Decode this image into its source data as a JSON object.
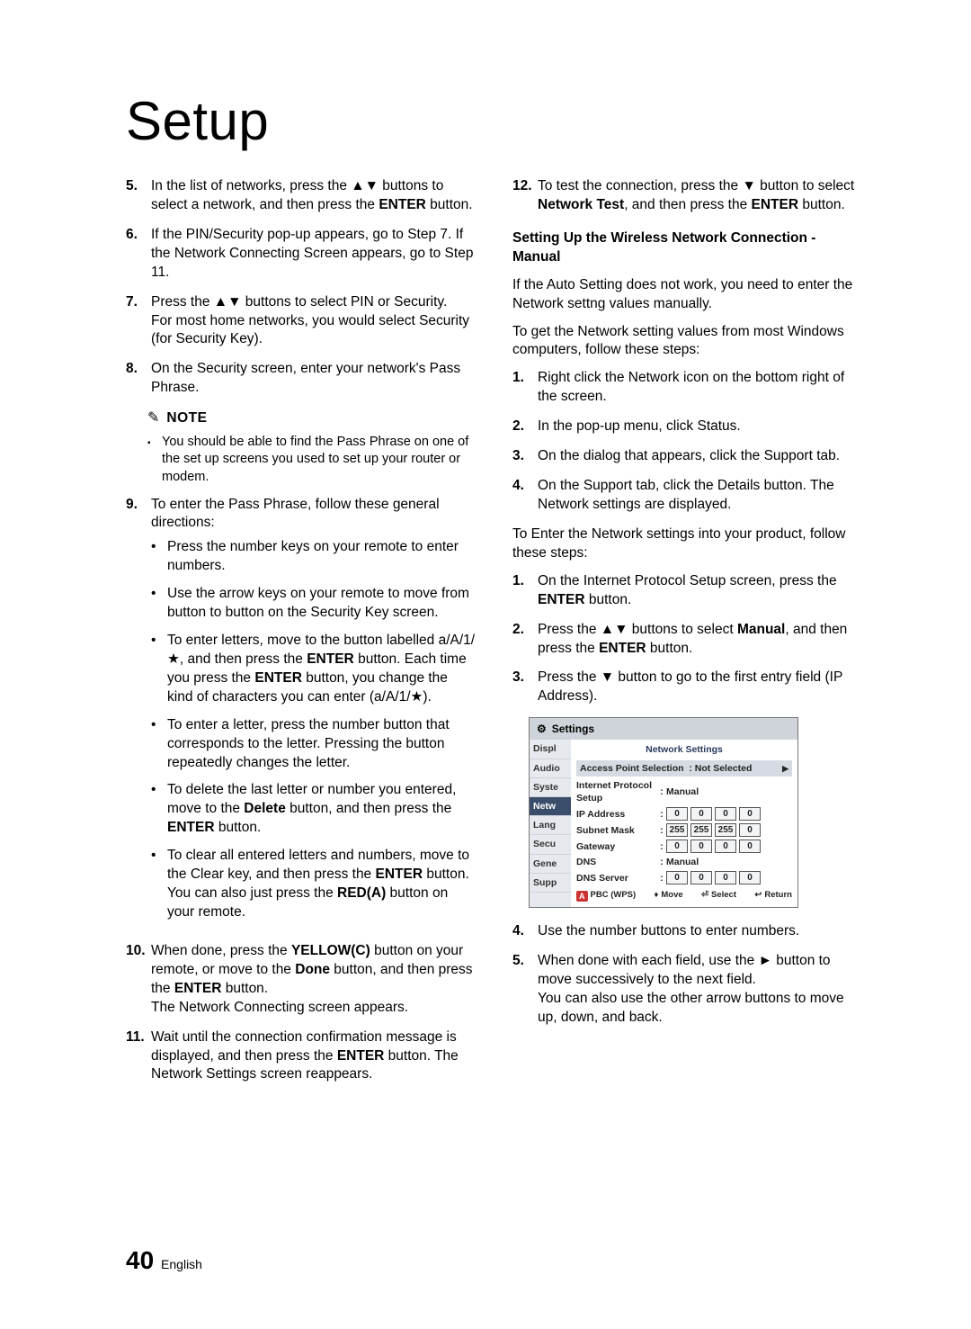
{
  "title": "Setup",
  "left": {
    "items": [
      {
        "num": "5.",
        "html": "In the list of networks, press the ▲▼ buttons to select a network, and then press the <b>ENTER</b> button."
      },
      {
        "num": "6.",
        "html": "If the PIN/Security pop-up appears, go to Step 7. If the Network Connecting Screen appears, go to Step 11."
      },
      {
        "num": "7.",
        "html": "Press the ▲▼ buttons to select PIN or Security.<br>For most home networks, you would select Security (for Security Key)."
      },
      {
        "num": "8.",
        "html": "On the Security screen, enter your network's Pass Phrase."
      }
    ],
    "note_label": "NOTE",
    "note_bullets": [
      "You should be able to find the Pass Phrase on one of the set up screens you used to set up your router or modem."
    ],
    "items2": [
      {
        "num": "9.",
        "html": "To enter the Pass Phrase, follow these general directions:",
        "bullets": [
          "Press the number keys on your remote to enter numbers.",
          "Use the arrow keys on your remote to move from button to button on the Security Key screen.",
          "To enter letters, move to the button labelled a/A/1/★, and then press the <b>ENTER</b> button. Each time you press the <b>ENTER</b> button, you change the kind of characters you can enter (a/A/1/★).",
          "To enter a letter, press the number button that corresponds to the letter. Pressing the button repeatedly changes the letter.",
          "To delete the last letter or number you entered, move to the <b>Delete</b> button, and then press the <b>ENTER</b> button.",
          "To clear all entered letters and numbers, move to the Clear key, and then press the <b>ENTER</b> button. You can also just press the <b>RED(A)</b> button on your remote."
        ]
      },
      {
        "num": "10.",
        "html": "When done, press the <b>YELLOW(C)</b> button on your remote, or move to the <b>Done</b> button, and then press the <b>ENTER</b> button.<br>The Network Connecting screen appears."
      },
      {
        "num": "11.",
        "html": "Wait until the connection confirmation message is displayed, and then press the <b>ENTER</b> button. The Network Settings screen reappears."
      }
    ]
  },
  "right": {
    "items_top": [
      {
        "num": "12.",
        "html": "To test the connection, press the ▼ button to select <b>Network Test</b>, and then press the <b>ENTER</b> button."
      }
    ],
    "sub_heading": "Setting Up the Wireless Network Connection - Manual",
    "para1": "If the Auto Setting does not work, you need to enter the Network settng values manually.",
    "para2": "To get the Network setting values from most Windows computers, follow these steps:",
    "steps_a": [
      {
        "num": "1.",
        "html": "Right click the Network icon on the bottom right of the screen."
      },
      {
        "num": "2.",
        "html": "In the pop-up menu, click Status."
      },
      {
        "num": "3.",
        "html": "On the dialog that appears, click the Support tab."
      },
      {
        "num": "4.",
        "html": "On the Support tab, click the Details button. The Network settings are displayed."
      }
    ],
    "para3": "To Enter the Network settings into your product, follow these steps:",
    "steps_b": [
      {
        "num": "1.",
        "html": "On the Internet Protocol Setup screen, press the <b>ENTER</b> button."
      },
      {
        "num": "2.",
        "html": "Press the ▲▼ buttons to select <b>Manual</b>, and then press the <b>ENTER</b> button."
      },
      {
        "num": "3.",
        "html": "Press the ▼ button to go to the first entry field (IP Address)."
      }
    ],
    "steps_c": [
      {
        "num": "4.",
        "html": "Use the number buttons to enter numbers."
      },
      {
        "num": "5.",
        "html": "When done with each field, use the ► button to move successively to the next field.<br>You can also use the other arrow buttons to move up, down, and back."
      }
    ]
  },
  "settings": {
    "header": "Settings",
    "tabs": [
      "Displ",
      "Audio",
      "Syste",
      "Netw",
      "Lang",
      "Secu",
      "Gene",
      "Supp"
    ],
    "panel_title": "Network Settings",
    "ap_row": {
      "label": "Access Point Selection",
      "value": "Not Selected"
    },
    "ips_row": {
      "label": "Internet Protocol Setup",
      "value": "Manual"
    },
    "fields": [
      {
        "label": "IP Address",
        "octets": [
          "0",
          "0",
          "0",
          "0"
        ]
      },
      {
        "label": "Subnet Mask",
        "octets": [
          "255",
          "255",
          "255",
          "0"
        ]
      },
      {
        "label": "Gateway",
        "octets": [
          "0",
          "0",
          "0",
          "0"
        ]
      }
    ],
    "dns_row": {
      "label": "DNS",
      "value": "Manual"
    },
    "dns_server": {
      "label": "DNS Server",
      "octets": [
        "0",
        "0",
        "0",
        "0"
      ]
    },
    "footer": {
      "a": "PBC (WPS)",
      "move": "Move",
      "select": "Select",
      "return": "Return"
    }
  },
  "footer": {
    "page": "40",
    "lang": "English"
  }
}
